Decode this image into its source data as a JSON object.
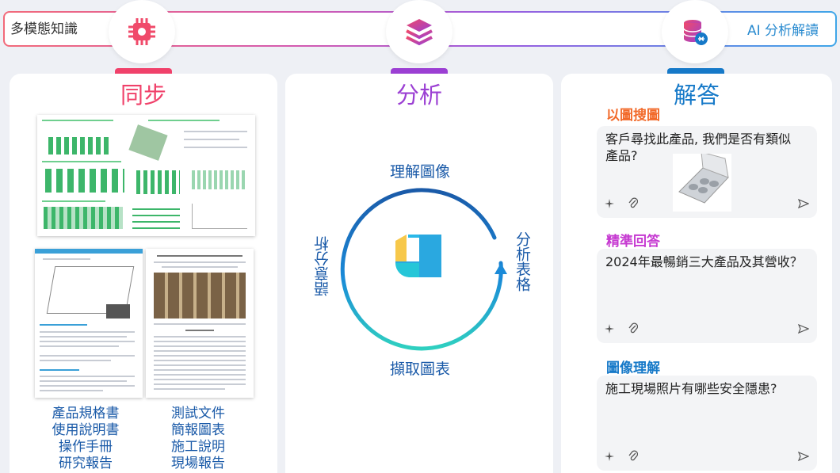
{
  "banner": {
    "left_label": "多模態知識",
    "right_label": "AI 分析解讀"
  },
  "columns": {
    "sync": {
      "title": "同步"
    },
    "analysis": {
      "title": "分析"
    },
    "answer": {
      "title": "解答"
    }
  },
  "docs": {
    "left_list": [
      "產品規格書",
      "使用說明書",
      "操作手冊",
      "研究報告"
    ],
    "right_list": [
      "測試文件",
      "簡報圖表",
      "施工說明",
      "現場報告"
    ]
  },
  "analysis": {
    "top": "理解圖像",
    "bottom": "擷取圖表",
    "left": "語意分析",
    "right": "分析表格"
  },
  "answers": [
    {
      "title": "以圖搜圖",
      "question": "客戶尋找此產品, 我們是否有類似 產品?"
    },
    {
      "title": "精準回答",
      "question": "2024年最暢銷三大產品及其營收？"
    },
    {
      "title": "圖像理解",
      "question": "施工現場照片有哪些安全隱患?"
    }
  ],
  "colors": {
    "sync": "#f0416a",
    "analysis": "#9b3fd3",
    "answer": "#1679c8"
  }
}
